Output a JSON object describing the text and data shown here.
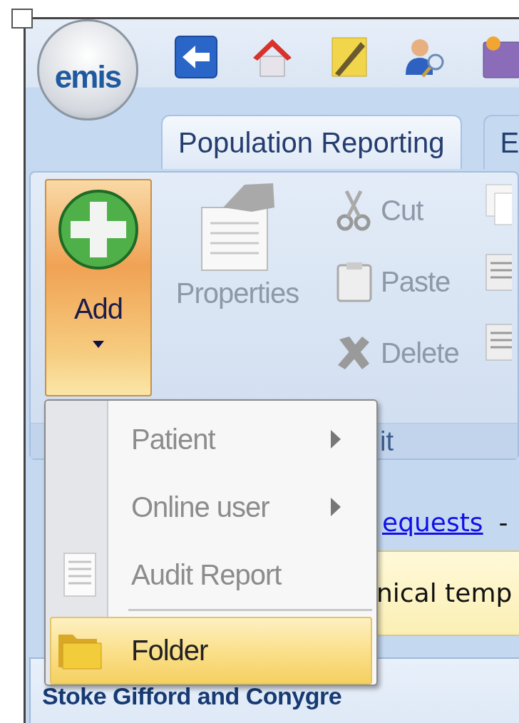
{
  "logo": {
    "text": "emis"
  },
  "tabs": [
    {
      "label": "Population Reporting",
      "selected": true
    },
    {
      "label": "E",
      "selected": false
    }
  ],
  "ribbon": {
    "add_button": {
      "label": "Add",
      "pressed": true
    },
    "large_buttons": [
      {
        "label": "Properties",
        "disabled": true
      }
    ],
    "small_buttons": [
      {
        "label": "Cut",
        "disabled": true
      },
      {
        "label": "Paste",
        "disabled": true
      },
      {
        "label": "Delete",
        "disabled": true
      }
    ],
    "group_label": "it"
  },
  "add_menu": {
    "items": [
      {
        "kind": "submenu",
        "label": "Patient",
        "disabled": true,
        "selected": false
      },
      {
        "kind": "submenu",
        "label": "Online user",
        "disabled": true,
        "selected": false
      },
      {
        "kind": "report",
        "label": "Audit Report",
        "disabled": true,
        "selected": false
      },
      {
        "kind": "separator"
      },
      {
        "kind": "folder",
        "label": "Folder",
        "disabled": false,
        "selected": true
      }
    ]
  },
  "link_row": {
    "link": "equests",
    "separator": "-"
  },
  "banner": {
    "text": "nical temp"
  },
  "panel": {
    "title": "Stoke Gifford and Conygre"
  }
}
